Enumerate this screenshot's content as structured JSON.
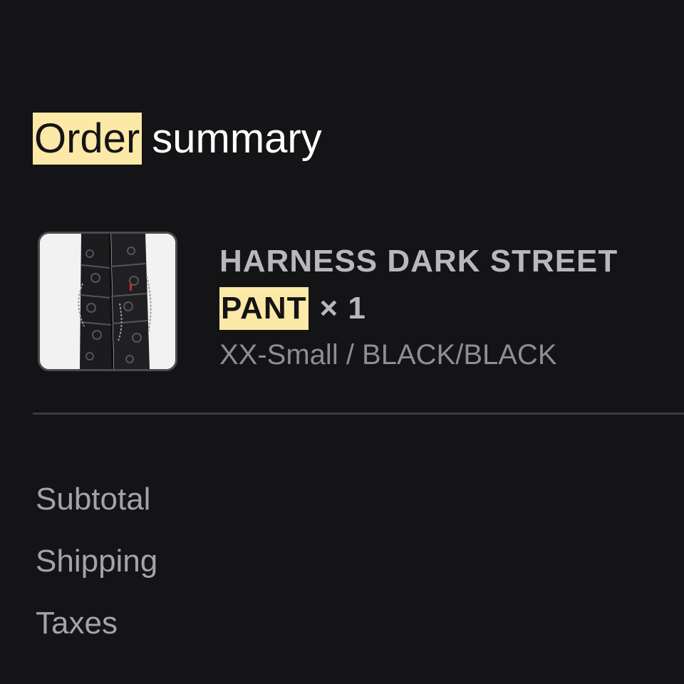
{
  "order_summary": {
    "title_highlight": "Order",
    "title_rest": "summary",
    "item": {
      "image_icon": "product-thumbnail",
      "name_line1": "HARNESS DARK STREET",
      "name_line2_highlight": "PANT",
      "quantity": "× 1",
      "variant": "XX-Small / BLACK/BLACK"
    },
    "totals": {
      "subtotal_label": "Subtotal",
      "shipping_label": "Shipping",
      "taxes_label": "Taxes"
    }
  },
  "colors": {
    "background": "#141416",
    "highlight": "#fde9a7",
    "divider": "#3c3c40"
  }
}
